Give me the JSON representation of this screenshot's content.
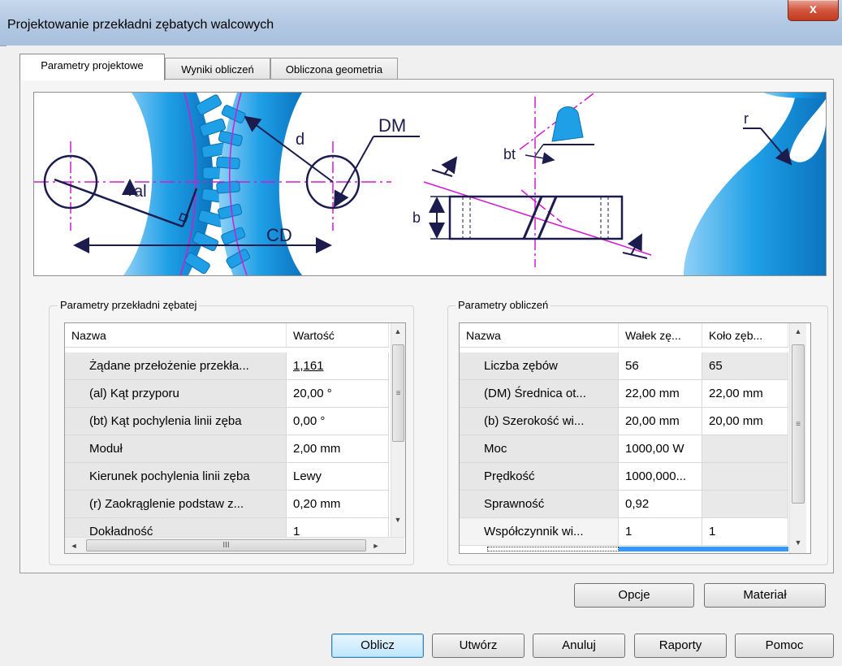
{
  "window": {
    "title": "Projektowanie przekładni zębatych walcowych",
    "close": "x"
  },
  "tabs": [
    {
      "label": "Parametry projektowe"
    },
    {
      "label": "Wyniki obliczeń"
    },
    {
      "label": "Obliczona geometria"
    }
  ],
  "figure": {
    "labels": {
      "d": "d",
      "DM": "DM",
      "al": "al",
      "CD": "CD",
      "bt": "bt",
      "b": "b",
      "r": "r"
    },
    "colors": {
      "gear": "#1e9fe6",
      "gear_dark": "#0b6fb7",
      "axis": "#d21ad2",
      "ink": "#111111"
    }
  },
  "gear_params": {
    "title": "Parametry przekładni zębatej",
    "columns": [
      "Nazwa",
      "Wartość"
    ],
    "rows": [
      {
        "name": "Żądane przełożenie przekła...",
        "value": "1,161"
      },
      {
        "name": "(al) Kąt przyporu",
        "value": "20,00 °"
      },
      {
        "name": "(bt) Kąt pochylenia linii zęba",
        "value": "0,00 °"
      },
      {
        "name": "Moduł",
        "value": "2,00 mm"
      },
      {
        "name": "Kierunek pochylenia linii zęba",
        "value": "Lewy"
      },
      {
        "name": "(r) Zaokrąglenie podstaw z...",
        "value": "0,20 mm"
      },
      {
        "name": "Dokładność",
        "value": "1"
      }
    ],
    "hscroll_grip": "III"
  },
  "calc_params": {
    "title": "Parametry obliczeń",
    "columns": [
      "Nazwa",
      "Wałek zę...",
      "Koło zęb..."
    ],
    "rows": [
      {
        "name": "Liczba zębów",
        "v1": "56",
        "v2": "65"
      },
      {
        "name": "(DM) Średnica ot...",
        "v1": "22,00 mm",
        "v2": "22,00 mm"
      },
      {
        "name": "(b) Szerokość wi...",
        "v1": "20,00 mm",
        "v2": "20,00 mm"
      },
      {
        "name": "Moc",
        "v1": "1000,00 W",
        "v2": ""
      },
      {
        "name": "Prędkość",
        "v1": "1000,000...",
        "v2": ""
      },
      {
        "name": "Sprawność",
        "v1": "0,92",
        "v2": ""
      },
      {
        "name": "Współczynnik wi...",
        "v1": "1",
        "v2": "1"
      }
    ]
  },
  "buttons": {
    "options": "Opcje",
    "material": "Materiał",
    "calculate": "Oblicz",
    "create": "Utwórz",
    "cancel": "Anuluj",
    "reports": "Raporty",
    "help": "Pomoc"
  },
  "scroll": {
    "up": "▲",
    "down": "▼",
    "left": "◄",
    "right": "►",
    "grip": "≡"
  }
}
